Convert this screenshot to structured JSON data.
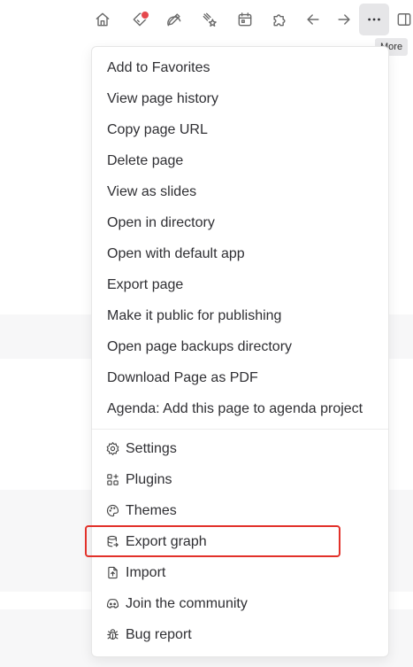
{
  "toolbar": {
    "items": [
      {
        "name": "home-icon"
      },
      {
        "name": "tag-icon",
        "badge": true
      },
      {
        "name": "edit-icon"
      },
      {
        "name": "sparkle-icon"
      },
      {
        "name": "calendar-icon"
      },
      {
        "name": "puzzle-icon"
      },
      {
        "name": "arrow-left-icon"
      },
      {
        "name": "arrow-right-icon"
      },
      {
        "name": "more-icon",
        "active": true
      },
      {
        "name": "sidebar-toggle-icon"
      }
    ],
    "tooltip": "More",
    "badge_color": "#e5484d"
  },
  "menu": {
    "page_items": [
      "Add to Favorites",
      "View page history",
      "Copy page URL",
      "Delete page",
      "View as slides",
      "Open in directory",
      "Open with default app",
      "Export page",
      "Make it public for publishing",
      "Open page backups directory",
      "Download Page as PDF",
      "Agenda: Add this page to agenda project"
    ],
    "app_items": [
      {
        "label": "Settings",
        "icon": "settings-icon"
      },
      {
        "label": "Plugins",
        "icon": "plugins-icon"
      },
      {
        "label": "Themes",
        "icon": "palette-icon"
      },
      {
        "label": "Export graph",
        "icon": "database-export-icon",
        "highlighted": true
      },
      {
        "label": "Import",
        "icon": "import-icon"
      },
      {
        "label": "Join the community",
        "icon": "discord-icon"
      },
      {
        "label": "Bug report",
        "icon": "bug-icon"
      }
    ]
  },
  "colors": {
    "highlight": "#e2312a",
    "text": "#2f2f33",
    "icon": "#6b6b6b"
  }
}
